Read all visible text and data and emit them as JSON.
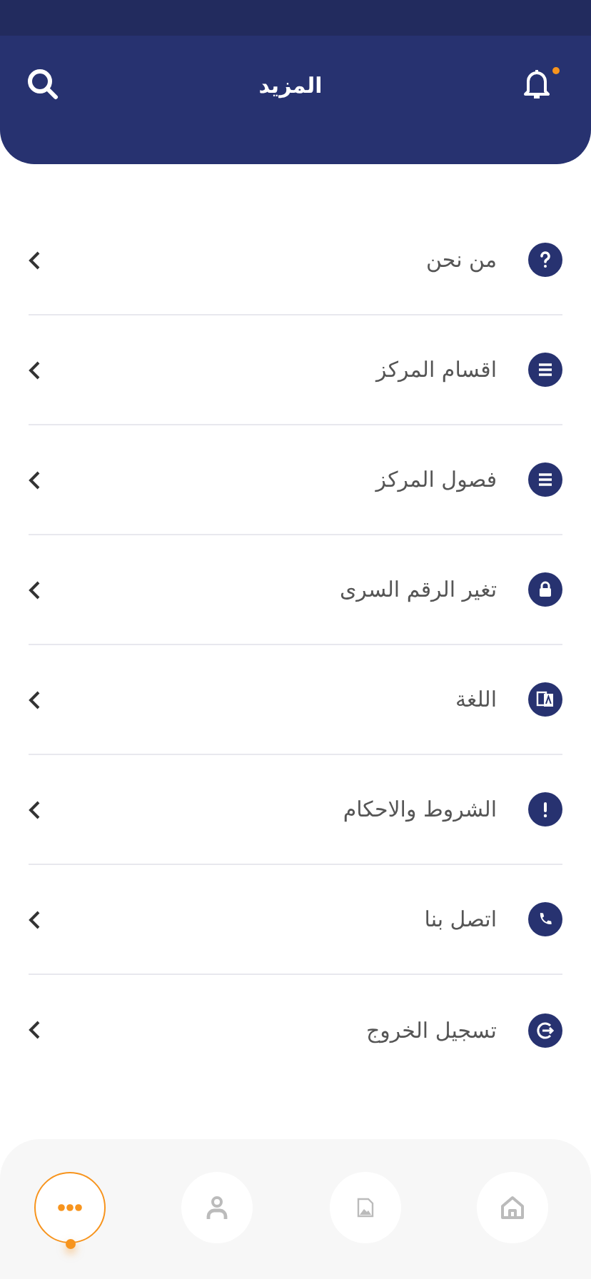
{
  "header": {
    "title": "المزيد",
    "has_unread_notifications": true
  },
  "menu": [
    {
      "label": "من نحن",
      "kind": "question"
    },
    {
      "label": "اقسام المركز",
      "kind": "list"
    },
    {
      "label": "فصول المركز",
      "kind": "list"
    },
    {
      "label": "تغير الرقم السرى",
      "kind": "lock"
    },
    {
      "label": "اللغة",
      "kind": "language"
    },
    {
      "label": "الشروط والاحكام",
      "kind": "alert"
    },
    {
      "label": "اتصل بنا",
      "kind": "phone"
    },
    {
      "label": "تسجيل الخروج",
      "kind": "logout"
    }
  ],
  "bottom_nav": [
    {
      "kind": "home",
      "selected": false
    },
    {
      "kind": "gallery",
      "selected": false
    },
    {
      "kind": "profile",
      "selected": false
    },
    {
      "kind": "more",
      "selected": true
    }
  ]
}
